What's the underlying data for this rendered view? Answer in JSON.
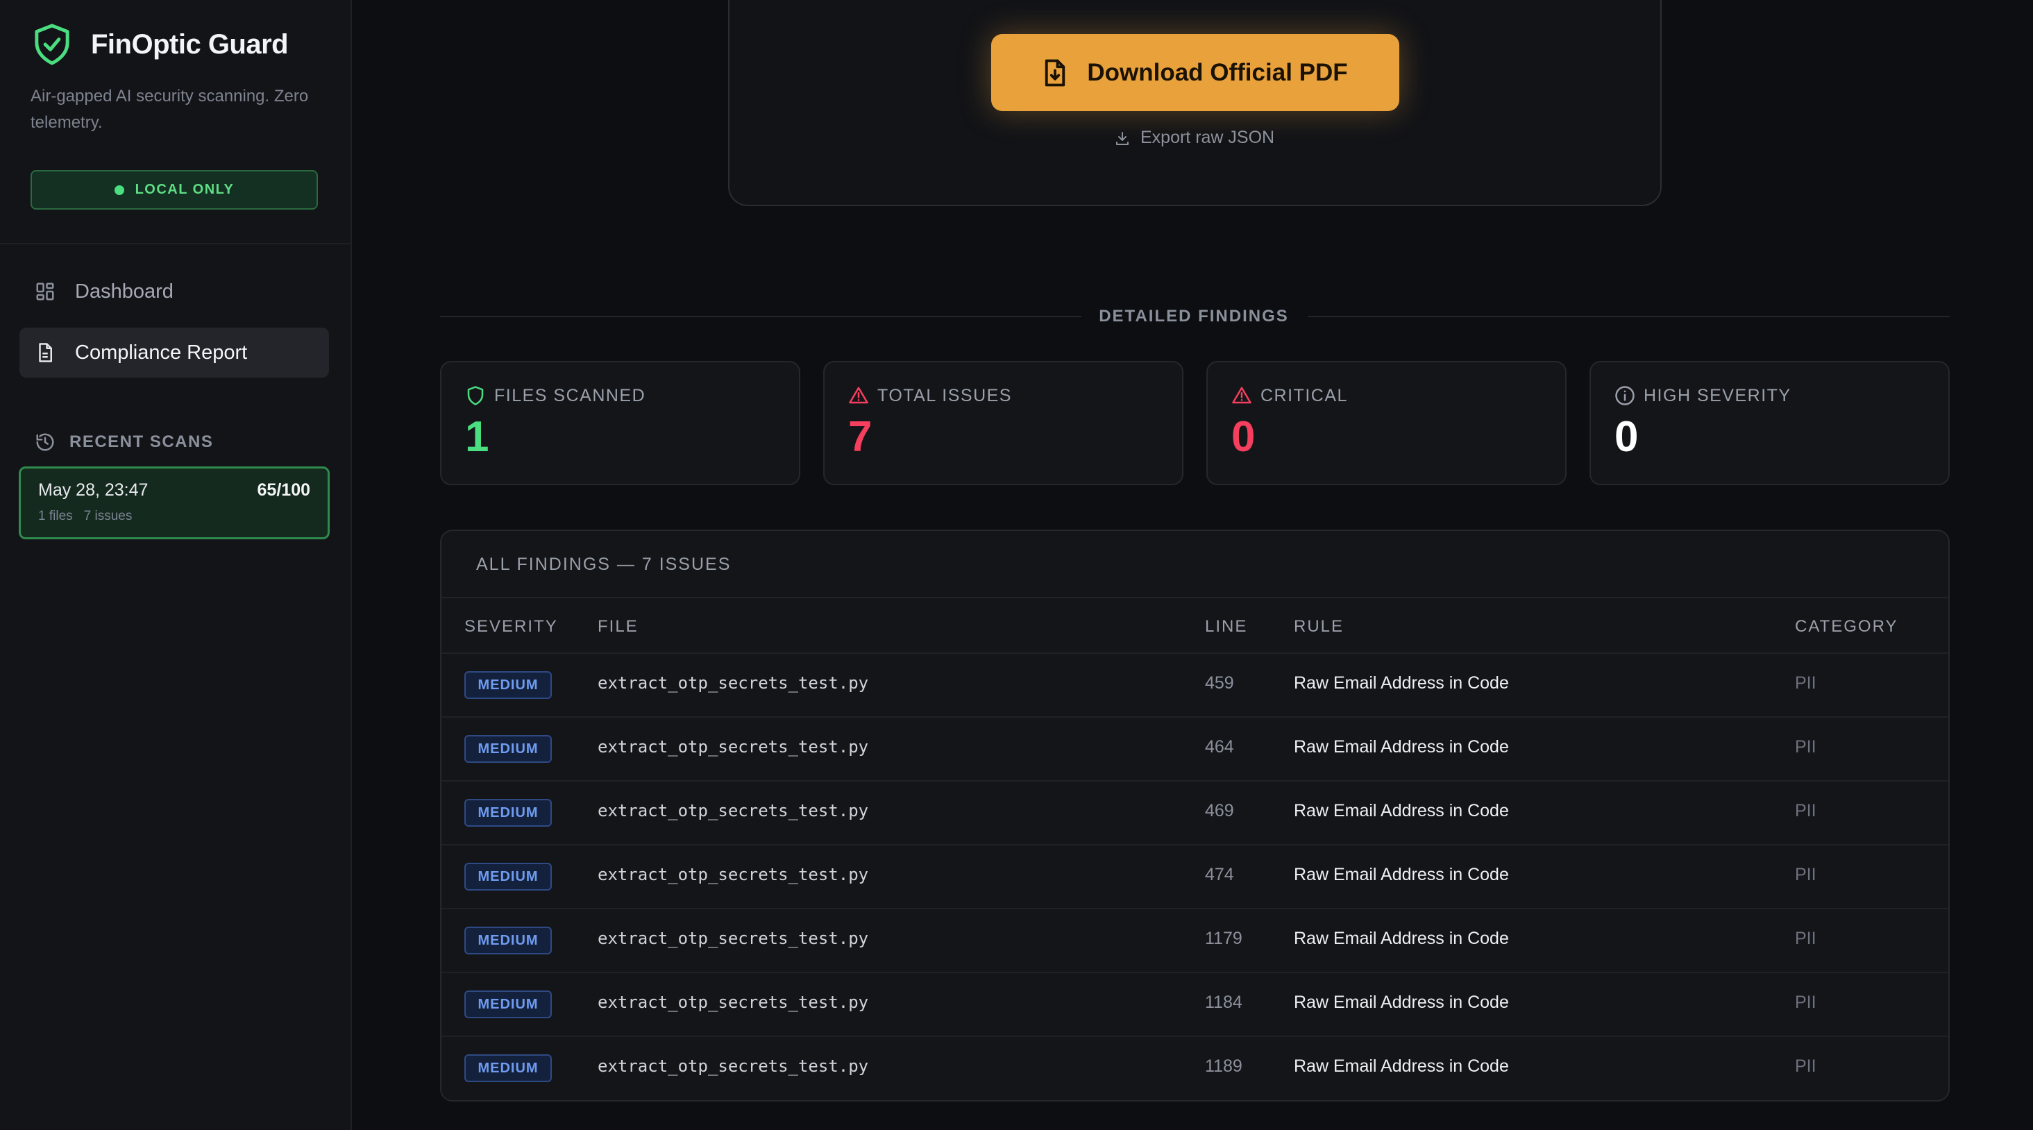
{
  "app": {
    "name": "FinOptic Guard",
    "tagline": "Air-gapped AI security scanning. Zero telemetry.",
    "local_badge": "LOCAL ONLY"
  },
  "nav": {
    "items": [
      {
        "label": "Dashboard",
        "icon": "grid-icon",
        "active": false
      },
      {
        "label": "Compliance Report",
        "icon": "document-icon",
        "active": true
      }
    ]
  },
  "recent_scans": {
    "heading": "RECENT SCANS",
    "items": [
      {
        "date": "May 28, 23:47",
        "score": "65/100",
        "files": "1 files",
        "issues": "7 issues"
      }
    ]
  },
  "report": {
    "download_label": "Download Official PDF",
    "export_label": "Export raw JSON"
  },
  "section_title": "DETAILED FINDINGS",
  "stats": [
    {
      "label": "FILES SCANNED",
      "value": "1",
      "icon": "shield-icon",
      "color": "#4ade80"
    },
    {
      "label": "TOTAL ISSUES",
      "value": "7",
      "icon": "warning-icon",
      "color": "#f43f5e"
    },
    {
      "label": "CRITICAL",
      "value": "0",
      "icon": "warning-icon",
      "color": "#f43f5e"
    },
    {
      "label": "HIGH SEVERITY",
      "value": "0",
      "icon": "info-icon",
      "color": "#ffffff"
    }
  ],
  "findings": {
    "title": "ALL FINDINGS — 7 ISSUES",
    "columns": {
      "severity": "SEVERITY",
      "file": "FILE",
      "line": "LINE",
      "rule": "RULE",
      "category": "CATEGORY"
    },
    "rows": [
      {
        "severity": "MEDIUM",
        "file": "extract_otp_secrets_test.py",
        "line": "459",
        "rule": "Raw Email Address in Code",
        "category": "PII"
      },
      {
        "severity": "MEDIUM",
        "file": "extract_otp_secrets_test.py",
        "line": "464",
        "rule": "Raw Email Address in Code",
        "category": "PII"
      },
      {
        "severity": "MEDIUM",
        "file": "extract_otp_secrets_test.py",
        "line": "469",
        "rule": "Raw Email Address in Code",
        "category": "PII"
      },
      {
        "severity": "MEDIUM",
        "file": "extract_otp_secrets_test.py",
        "line": "474",
        "rule": "Raw Email Address in Code",
        "category": "PII"
      },
      {
        "severity": "MEDIUM",
        "file": "extract_otp_secrets_test.py",
        "line": "1179",
        "rule": "Raw Email Address in Code",
        "category": "PII"
      },
      {
        "severity": "MEDIUM",
        "file": "extract_otp_secrets_test.py",
        "line": "1184",
        "rule": "Raw Email Address in Code",
        "category": "PII"
      },
      {
        "severity": "MEDIUM",
        "file": "extract_otp_secrets_test.py",
        "line": "1189",
        "rule": "Raw Email Address in Code",
        "category": "PII"
      }
    ]
  },
  "colors": {
    "accent_orange": "#e9a23b",
    "success_green": "#4ade80",
    "danger_red": "#f43f5e",
    "medium_blue": "#6f9cf2"
  }
}
